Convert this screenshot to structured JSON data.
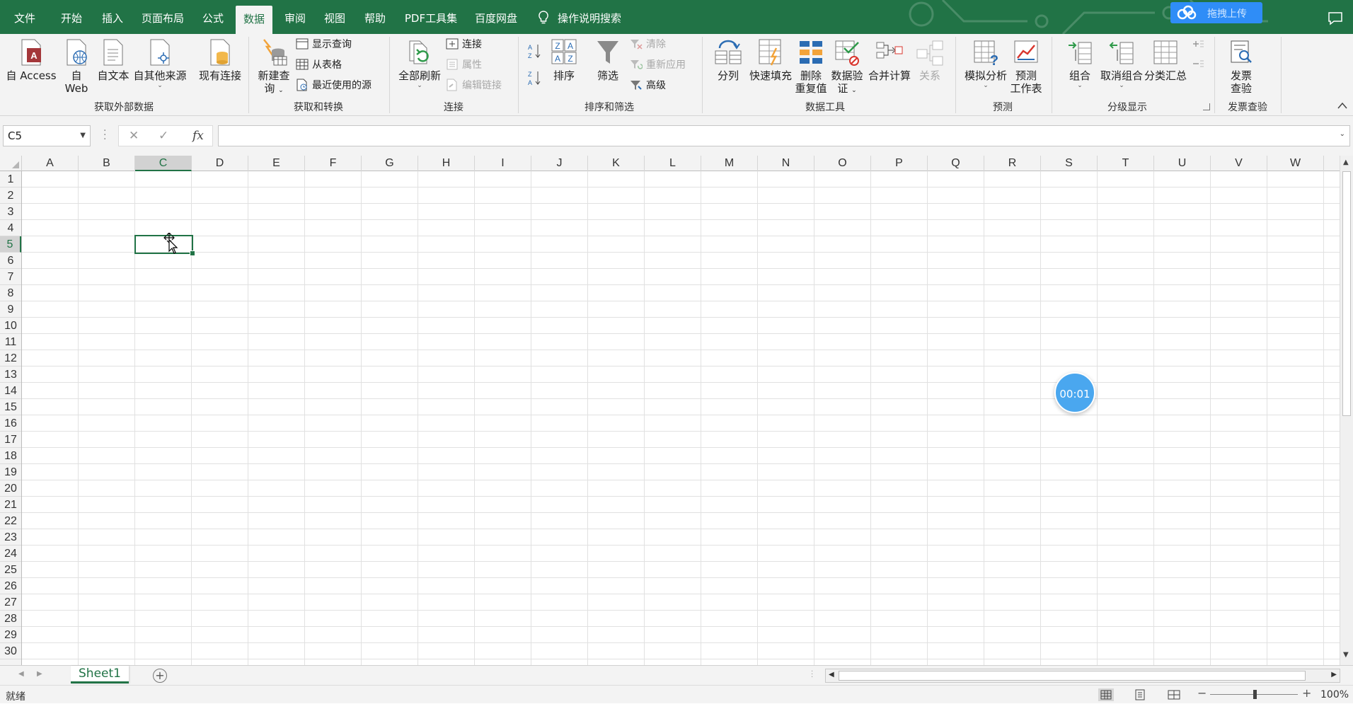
{
  "tabs": [
    {
      "label": "文件"
    },
    {
      "label": "开始"
    },
    {
      "label": "插入"
    },
    {
      "label": "页面布局"
    },
    {
      "label": "公式"
    },
    {
      "label": "数据"
    },
    {
      "label": "审阅"
    },
    {
      "label": "视图"
    },
    {
      "label": "帮助"
    },
    {
      "label": "PDF工具集"
    },
    {
      "label": "百度网盘"
    }
  ],
  "active_tab": "数据",
  "tell_me": "操作说明搜索",
  "baidu_upload": "拖拽上传",
  "ribbon": {
    "get_external": {
      "label": "获取外部数据",
      "access_label": "自 Access",
      "web_line1": "自",
      "web_line2": "Web",
      "text_label": "自文本",
      "other_label": "自其他来源",
      "existing_label": "现有连接"
    },
    "get_transform": {
      "label": "获取和转换",
      "new_query_line1": "新建查",
      "new_query_line2": "询",
      "show_queries": "显示查询",
      "from_table": "从表格",
      "recent_sources": "最近使用的源"
    },
    "connections": {
      "label": "连接",
      "refresh_all": "全部刷新",
      "connections": "连接",
      "properties": "属性",
      "edit_links": "编辑链接"
    },
    "sort_filter": {
      "label": "排序和筛选",
      "sort": "排序",
      "filter": "筛选",
      "clear": "清除",
      "reapply": "重新应用",
      "advanced": "高级"
    },
    "data_tools": {
      "label": "数据工具",
      "text_to_columns": "分列",
      "flash_fill": "快速填充",
      "remove_dup_line1": "删除",
      "remove_dup_line2": "重复值",
      "validation_line1": "数据验",
      "validation_line2": "证",
      "consolidate": "合并计算",
      "relationships": "关系"
    },
    "forecast": {
      "label": "预测",
      "what_if": "模拟分析",
      "forecast_line1": "预测",
      "forecast_line2": "工作表"
    },
    "outline": {
      "label": "分级显示",
      "group": "组合",
      "ungroup": "取消组合",
      "subtotal": "分类汇总"
    },
    "invoice": {
      "label": "发票查验",
      "invoice_line1": "发票",
      "invoice_line2": "查验"
    }
  },
  "formula_bar": {
    "name_box": "C5",
    "fx": "fx",
    "formula": ""
  },
  "columns": [
    "A",
    "B",
    "C",
    "D",
    "E",
    "F",
    "G",
    "H",
    "I",
    "J",
    "K",
    "L",
    "M",
    "N",
    "O",
    "P",
    "Q",
    "R",
    "S",
    "T",
    "U",
    "V",
    "W"
  ],
  "rows": [
    "1",
    "2",
    "3",
    "4",
    "5",
    "6",
    "7",
    "8",
    "9",
    "10",
    "11",
    "12",
    "13",
    "14",
    "15",
    "16",
    "17",
    "18",
    "19",
    "20",
    "21",
    "22",
    "23",
    "24",
    "25",
    "26",
    "27",
    "28",
    "29",
    "30"
  ],
  "selected_cell": {
    "column": "C",
    "row": "5"
  },
  "timer": "00:01",
  "sheet_tab": "Sheet1",
  "status": "就绪",
  "zoom": "100%",
  "colors": {
    "accent": "#217346",
    "timer": "#4aa7ef",
    "baidu": "#2f8df7"
  }
}
